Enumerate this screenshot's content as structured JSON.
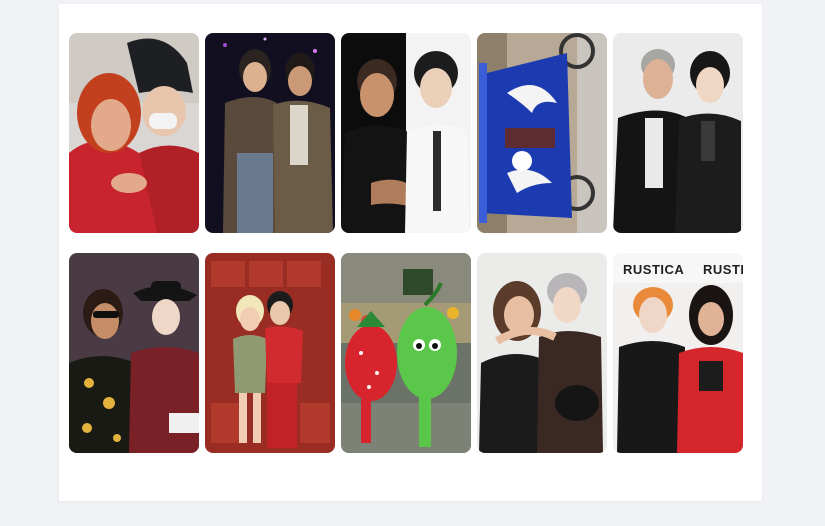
{
  "gallery": {
    "tiles": [
      {
        "name": "photo-woman-red-hair-with-bucket-hat"
      },
      {
        "name": "photo-two-men-denim-jackets"
      },
      {
        "name": "photo-two-men-black-and-white"
      },
      {
        "name": "photo-blue-cart-flame-design"
      },
      {
        "name": "photo-two-men-leather-jackets"
      },
      {
        "name": "photo-man-sunglasses-and-cowboy-hat"
      },
      {
        "name": "photo-couple-red-crates"
      },
      {
        "name": "photo-fruit-mascots-market"
      },
      {
        "name": "photo-woman-and-silver-hair-man"
      },
      {
        "name": "photo-rustica-backdrop-duo",
        "sign_text": "RUSTICA"
      }
    ]
  }
}
